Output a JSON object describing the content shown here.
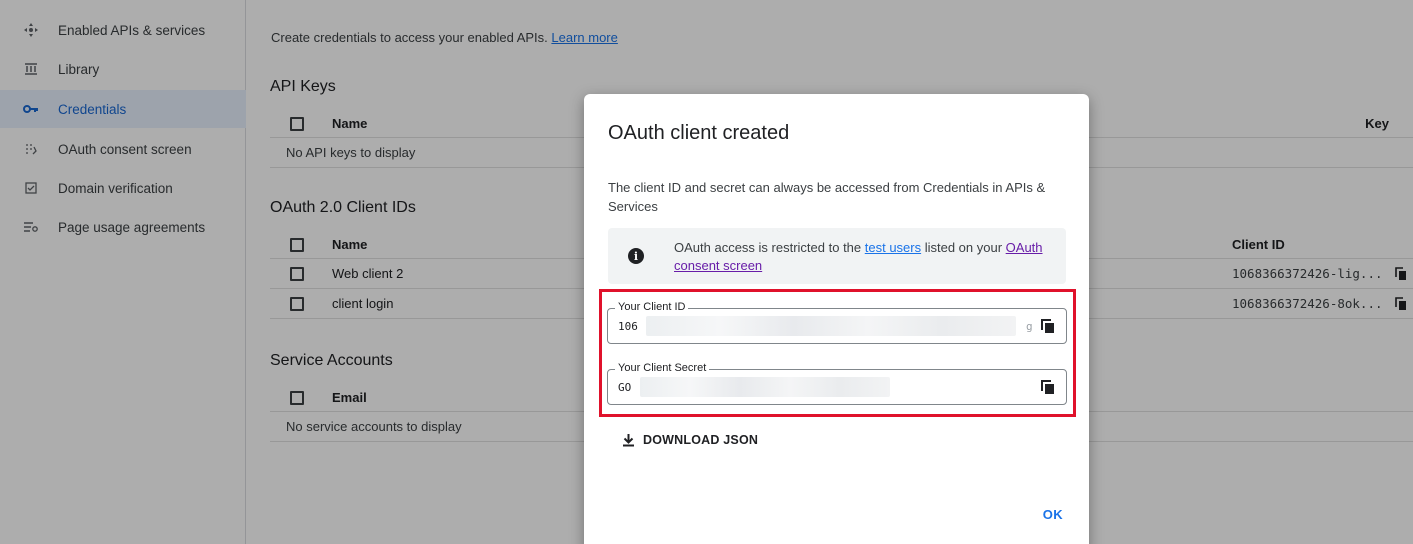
{
  "sidebar": {
    "items": [
      {
        "label": "Enabled APIs & services",
        "icon": "api-icon"
      },
      {
        "label": "Library",
        "icon": "library-icon"
      },
      {
        "label": "Credentials",
        "icon": "key-icon",
        "active": true
      },
      {
        "label": "OAuth consent screen",
        "icon": "consent-icon"
      },
      {
        "label": "Domain verification",
        "icon": "checkbox-icon"
      },
      {
        "label": "Page usage agreements",
        "icon": "settings-list-icon"
      }
    ]
  },
  "main": {
    "intro_text": "Create credentials to access your enabled APIs.",
    "intro_link": "Learn more",
    "api_keys": {
      "title": "API Keys",
      "col_name": "Name",
      "col_key": "Key",
      "empty_text": "No API keys to display"
    },
    "oauth_clients": {
      "title": "OAuth 2.0 Client IDs",
      "col_name": "Name",
      "col_client_id": "Client ID",
      "rows": [
        {
          "name": "Web client 2",
          "client_id": "1068366372426-lig..."
        },
        {
          "name": "client login",
          "client_id": "1068366372426-8ok..."
        }
      ]
    },
    "service_accounts": {
      "title": "Service Accounts",
      "col_email": "Email",
      "empty_text": "No service accounts to display"
    }
  },
  "dialog": {
    "title": "OAuth client created",
    "description": "The client ID and secret can always be accessed from Credentials in APIs & Services",
    "info": {
      "prefix": "OAuth access is restricted to the ",
      "link1": "test users",
      "middle": " listed on your ",
      "link2": "OAuth consent screen"
    },
    "client_id": {
      "label": "Your Client ID",
      "value_prefix": "106",
      "value_tail": "g"
    },
    "client_secret": {
      "label": "Your Client Secret",
      "value_prefix": "GO"
    },
    "download_label": "DOWNLOAD JSON",
    "ok_label": "OK"
  },
  "colors": {
    "accent": "#1a73e8",
    "highlight_border": "#e0112b",
    "active_bg": "#e8f0fe"
  }
}
